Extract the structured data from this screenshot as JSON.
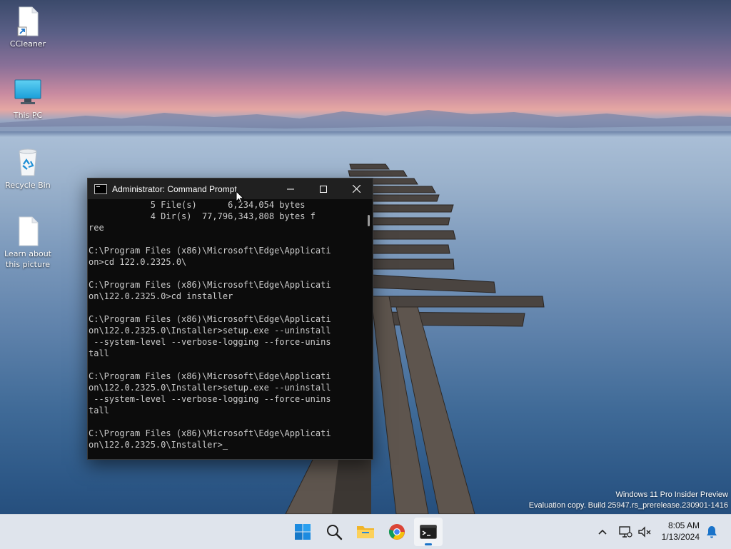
{
  "desktop": {
    "icons": [
      {
        "label": "CCleaner"
      },
      {
        "label": "This PC"
      },
      {
        "label": "Recycle Bin"
      },
      {
        "label": "Learn about this picture"
      }
    ]
  },
  "cmd_window": {
    "title": "Administrator: Command Prompt",
    "lines": [
      "            5 File(s)      6,234,054 bytes",
      "            4 Dir(s)  77,796,343,808 bytes f",
      "ree",
      "",
      "C:\\Program Files (x86)\\Microsoft\\Edge\\Applicati",
      "on>cd 122.0.2325.0\\",
      "",
      "C:\\Program Files (x86)\\Microsoft\\Edge\\Applicati",
      "on\\122.0.2325.0>cd installer",
      "",
      "C:\\Program Files (x86)\\Microsoft\\Edge\\Applicati",
      "on\\122.0.2325.0\\Installer>setup.exe --uninstall",
      " --system-level --verbose-logging --force-unins",
      "tall",
      "",
      "C:\\Program Files (x86)\\Microsoft\\Edge\\Applicati",
      "on\\122.0.2325.0\\Installer>setup.exe --uninstall",
      " --system-level --verbose-logging --force-unins",
      "tall",
      "",
      "C:\\Program Files (x86)\\Microsoft\\Edge\\Applicati",
      "on\\122.0.2325.0\\Installer>"
    ]
  },
  "watermark": {
    "line1": "Windows 11 Pro Insider Preview",
    "line2": "Evaluation copy. Build 25947.rs_prerelease.230901-1416"
  },
  "taskbar": {
    "apps": [
      {
        "icon": "windows-start-icon"
      },
      {
        "icon": "search-icon"
      },
      {
        "icon": "file-explorer-icon"
      },
      {
        "icon": "chrome-icon"
      },
      {
        "icon": "terminal-icon",
        "active": true
      }
    ],
    "clock": {
      "time": "8:05 AM",
      "date": "1/13/2024"
    }
  },
  "colors": {
    "taskbar_bg": "#dfe4ec",
    "console_bg": "#0c0c0c",
    "console_fg": "#cccccc",
    "accent": "#1a73c9"
  }
}
